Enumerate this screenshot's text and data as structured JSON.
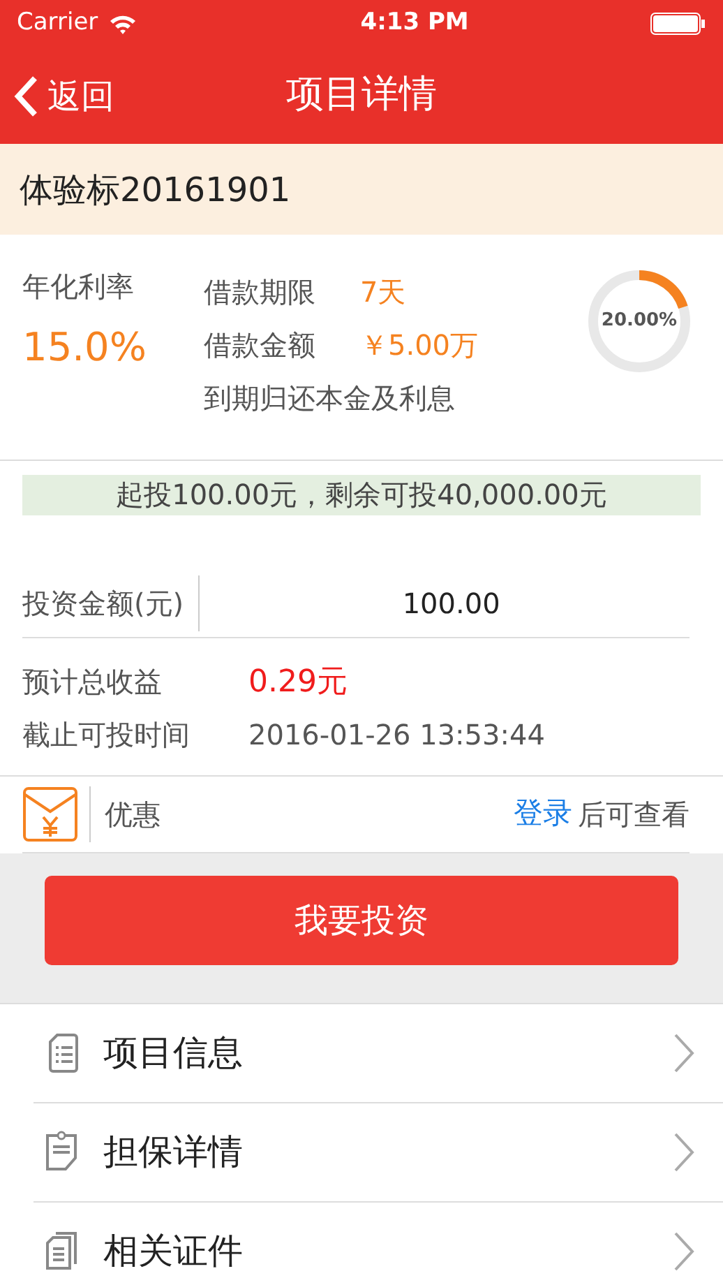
{
  "status_bar": {
    "carrier": "Carrier",
    "time": "4:13 PM"
  },
  "nav": {
    "back": "返回",
    "title": "项目详情"
  },
  "project_name": "体验标20161901",
  "rate": {
    "label": "年化利率",
    "value": "15.0%"
  },
  "terms": [
    {
      "label": "借款期限",
      "value": "7天"
    },
    {
      "label": "借款金额",
      "value": "￥5.00万"
    }
  ],
  "repayment": "到期归还本金及利息",
  "progress": {
    "level": 0.2,
    "reading": "20.00%"
  },
  "notice": "起投100.00元，剩余可投40,000.00元",
  "amount": {
    "label": "投资金额(元)",
    "value": "100.00"
  },
  "earnings": {
    "label": "预计总收益",
    "value": "0.29元"
  },
  "deadline": {
    "label": "截止可投时间",
    "value": "2016-01-26 13:53:44"
  },
  "coupon": {
    "label": "优惠",
    "link": "登录",
    "hint": "后可查看"
  },
  "invest_button": "我要投资",
  "menu": [
    {
      "label": "项目信息"
    },
    {
      "label": "担保详情"
    },
    {
      "label": "相关证件"
    }
  ]
}
